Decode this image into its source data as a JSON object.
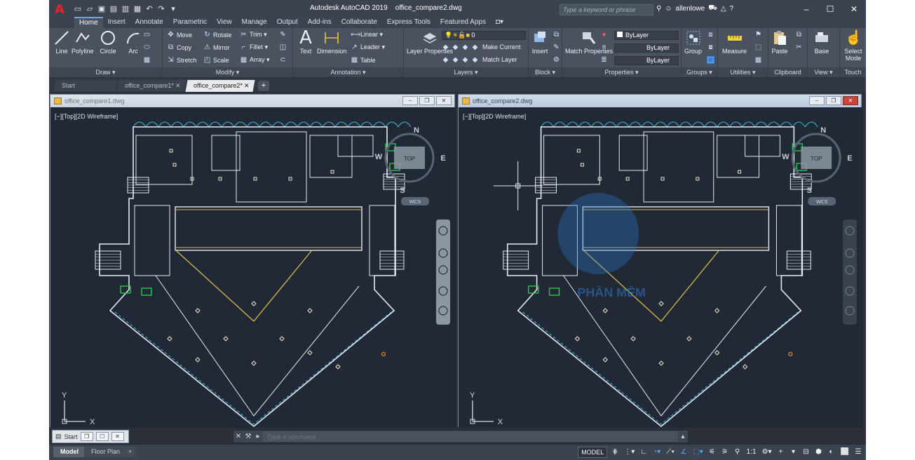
{
  "app": {
    "title": "Autodesk AutoCAD 2019",
    "document": "office_compare2.dwg",
    "search_placeholder": "Type a keyword or phrase",
    "user": "allenlowe",
    "logo_letter": "A"
  },
  "ribbon_tabs": [
    "Home",
    "Insert",
    "Annotate",
    "Parametric",
    "View",
    "Manage",
    "Output",
    "Add-ins",
    "Collaborate",
    "Express Tools",
    "Featured Apps"
  ],
  "ribbon": {
    "draw": {
      "title": "Draw ▾",
      "line": "Line",
      "polyline": "Polyline",
      "circle": "Circle",
      "arc": "Arc"
    },
    "modify": {
      "title": "Modify ▾",
      "move": "Move",
      "rotate": "Rotate",
      "trim": "Trim ▾",
      "copy": "Copy",
      "mirror": "Mirror",
      "fillet": "Fillet ▾",
      "stretch": "Stretch",
      "scale": "Scale",
      "array": "Array ▾"
    },
    "annotation": {
      "title": "Annotation ▾",
      "text": "Text",
      "dimension": "Dimension",
      "linear": "Linear ▾",
      "leader": "Leader ▾",
      "table": "Table"
    },
    "layers": {
      "title": "Layers ▾",
      "layer_properties": "Layer Properties",
      "layer_value": "0",
      "make_current": "Make Current",
      "match_layer": "Match Layer"
    },
    "block": {
      "title": "Block ▾",
      "insert": "Insert"
    },
    "properties": {
      "title": "Properties ▾",
      "match_properties": "Match Properties",
      "bylayer1": "ByLayer",
      "bylayer2": "ByLayer",
      "bylayer3": "ByLayer"
    },
    "groups": {
      "title": "Groups ▾",
      "group": "Group"
    },
    "utilities": {
      "title": "Utilities ▾",
      "measure": "Measure"
    },
    "clipboard": {
      "title": "Clipboard",
      "paste": "Paste"
    },
    "view": {
      "title": "View ▾",
      "base": "Base"
    },
    "touch": {
      "title": "Touch",
      "select_mode": "Select Mode"
    }
  },
  "doc_tabs": [
    {
      "label": "Start"
    },
    {
      "label": "office_compare1*"
    },
    {
      "label": "office_compare2*"
    }
  ],
  "windows": {
    "left": {
      "title": "office_compare1.dwg",
      "view_label": "[−][Top][2D Wireframe]"
    },
    "right": {
      "title": "office_compare2.dwg",
      "view_label": "[−][Top][2D Wireframe]"
    }
  },
  "viewcube": {
    "n": "N",
    "s": "S",
    "e": "E",
    "w": "W",
    "top": "TOP",
    "wcs": "WCS"
  },
  "ucs": {
    "x": "X",
    "y": "Y"
  },
  "watermark": "PHẦN MỀM",
  "minimized_window": {
    "label": "Start"
  },
  "command_line": {
    "placeholder": "Type a command"
  },
  "status": {
    "layout_tabs": [
      "Model",
      "Floor Plan"
    ],
    "model_label": "MODEL",
    "scale": "1:1"
  },
  "colors": {
    "accent": "#56a7ff",
    "plan_white": "#e8ecf2",
    "plan_cyan": "#3fbfd8",
    "plan_yellow": "#d8b84a",
    "plan_green": "#29c94a"
  }
}
